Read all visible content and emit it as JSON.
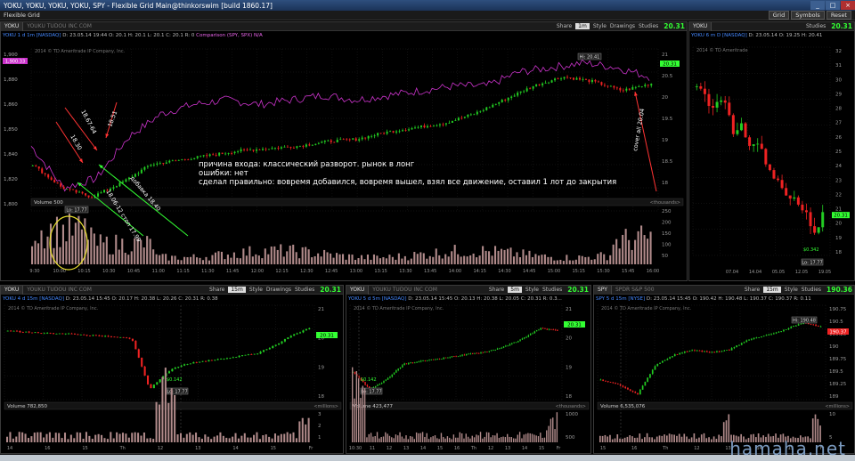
{
  "window": {
    "title": "YOKU, YOKU, YOKU, YOKU, SPY - Flexible Grid Main@thinkorswim [build 1860.17]",
    "menu_label": "Flexible Grid",
    "top_buttons": [
      "Grid",
      "Symbols",
      "Reset"
    ]
  },
  "panel_tools": [
    "Share",
    "Style",
    "Drawings",
    "Studies"
  ],
  "panels": {
    "main": {
      "symbol": "YOKU",
      "description": "YOUKU TUDOU INC COM",
      "timeframe": "1m",
      "last": "20.31",
      "ohlc": {
        "label": "YOKU 1 d 1m [NASDAQ]",
        "d": "D: 23.05.14 19:44",
        "o": "O: 20.1",
        "h": "H: 20.1",
        "l": "L: 20.1",
        "c": "C: 20.1",
        "r": "R: 0",
        "compare": "Comparison (SPY, SPX)",
        "na": "N/A"
      },
      "copyright": "2014 © TD Ameritrade IP Company, Inc.",
      "price_ticks": [
        "21",
        "20.5",
        "20",
        "19.5",
        "19",
        "18.5",
        "18",
        "17.5"
      ],
      "spy_ticks": [
        "1,900",
        "1,880",
        "1,860",
        "1,850",
        "1,840",
        "1,820",
        "1,800"
      ],
      "spy_badge": "1,900.33",
      "time_ticks": [
        "9:30",
        "10:00",
        "10:15",
        "10:30",
        "10:45",
        "11:00",
        "11:15",
        "11:30",
        "11:45",
        "12:00",
        "12:15",
        "12:30",
        "12:45",
        "13:00",
        "13:15",
        "13:30",
        "13:45",
        "14:00",
        "14:15",
        "14:30",
        "14:45",
        "15:00",
        "15:15",
        "15:30",
        "15:45",
        "16:00"
      ],
      "hi_label": "Hi: 20.41",
      "lo_label": "Lo: 17.77",
      "volume": {
        "label": "Volume",
        "value": "500",
        "units": "<thousands>",
        "ticks": [
          "250",
          "200",
          "150",
          "100",
          "50"
        ]
      },
      "annotations": {
        "entry_reason": "причина входа: классический разворот. рынок в лонг",
        "errors": "ошибки: нет",
        "did_right": "сделал правильно: вовремя добавился, вовремя вышел, взял все движение, оставил 1 лот до закрытия",
        "buy1": "18.06-12 стоп 17.99",
        "add": "добавка 18.40",
        "sell1": "18.30",
        "sell2": "18.67-64",
        "sell3": "18.51",
        "cover": "cover all 20.04"
      }
    },
    "right": {
      "symbol": "YOKU",
      "ohlc": {
        "label": "YOKU 6 m D [NASDAQ]",
        "d": "D: 23.05.14",
        "o": "O: 19.25",
        "h": "H: 20.41"
      },
      "copyright": "2014 © TD Ameritrade",
      "last": "20.31",
      "price_ticks": [
        "32",
        "31",
        "30",
        "29",
        "28",
        "27",
        "26",
        "25",
        "24",
        "23",
        "22",
        "21",
        "20",
        "19",
        "18"
      ],
      "time_ticks": [
        "07.04",
        "14.04",
        "05.05",
        "12.05",
        "19.05"
      ],
      "lo_label": "Lo: 17.77",
      "div_label": "$0.342"
    },
    "bl": {
      "symbol": "YOKU",
      "description": "YOUKU TUDOU INC COM",
      "timeframe": "15m",
      "last": "20.31",
      "ohlc": {
        "label": "YOKU 4 d 15m [NASDAQ]",
        "d": "D: 23.05.14 15:45",
        "o": "O: 20.17",
        "h": "H: 20.38",
        "l": "L: 20.26",
        "c": "C: 20.31",
        "r": "R: 0.38"
      },
      "copyright": "2014 © TD Ameritrade IP Company, Inc.",
      "price_ticks": [
        "21",
        "20",
        "19",
        "18"
      ],
      "time_ticks": [
        "14",
        "16",
        "15",
        "Th",
        "12",
        "13",
        "14",
        "15",
        "Fr"
      ],
      "lo_label": "Lo: 17.77",
      "div_label": "$0.142",
      "volume": {
        "label": "Volume",
        "value": "782,850",
        "units": "<millions>",
        "ticks": [
          "3",
          "2",
          "1"
        ]
      }
    },
    "bm": {
      "symbol": "YOKU",
      "description": "YOUKU TUDOU INC COM",
      "timeframe": "5m",
      "last": "20.31",
      "ohlc": {
        "label": "YOKU 5 d 5m [NASDAQ]",
        "d": "D: 23.05.14 15:45",
        "o": "O: 20.13",
        "h": "H: 20.38",
        "l": "L: 20.05",
        "c": "C: 20.31",
        "r": "R: 0.3..."
      },
      "copyright": "2014 © TD Ameritrade IP Company, Inc.",
      "price_ticks": [
        "21",
        "20",
        "19",
        "18"
      ],
      "time_ticks": [
        "10:30",
        "11",
        "12",
        "13",
        "14",
        "15",
        "16",
        "Th",
        "12",
        "13",
        "14",
        "15",
        "Fr"
      ],
      "lo_label": "Lo: 17.77",
      "div_label": "$0.142",
      "volume": {
        "label": "Volume",
        "value": "423,477",
        "units": "<thousands>",
        "ticks": [
          "1000",
          "500"
        ]
      }
    },
    "br": {
      "symbol": "SPY",
      "description": "SPDR S&P 500",
      "timeframe": "15m",
      "last": "190.36",
      "ohlc": {
        "label": "SPY 5 d 15m [NYSE]",
        "d": "D: 23.05.14 15:45",
        "o": "O: 190.42",
        "h": "H: 190.48",
        "l": "L: 190.37",
        "c": "C: 190.37",
        "r": "R: 0.11"
      },
      "copyright": "2014 © TD Ameritrade IP Company, Inc.",
      "price_ticks": [
        "190.75",
        "190.5",
        "190.25",
        "190",
        "189.75",
        "189.5",
        "189.25",
        "189"
      ],
      "hi_label": "Hi: 190.48",
      "time_ticks": [
        "15",
        "16",
        "Th",
        "12",
        "13",
        "14",
        "15",
        "Fr"
      ],
      "badge": "190.37",
      "volume": {
        "label": "Volume",
        "value": "6,535,076",
        "units": "<millions>",
        "ticks": [
          "10",
          "5"
        ]
      }
    }
  },
  "watermark": "hamaha.net",
  "colors": {
    "up": "#22cc22",
    "down": "#ee2222",
    "compare": "#cc33cc",
    "volume": "#b08a8a",
    "accent": "#33ff33"
  }
}
